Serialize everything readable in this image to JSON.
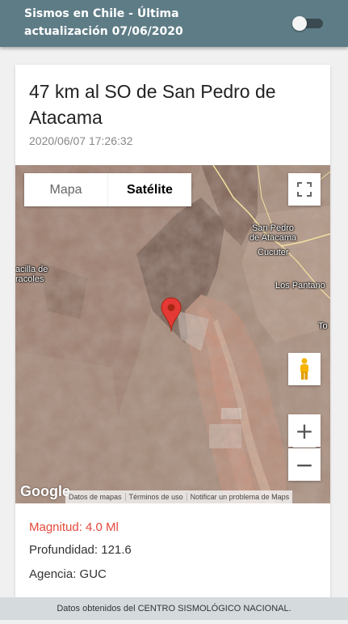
{
  "header": {
    "title": "Sismos en Chile - Última actualización 07/06/2020",
    "dark_mode_toggle": "off"
  },
  "event": {
    "title": "47 km al SO de San Pedro de Atacama",
    "datetime": "2020/06/07 17:26:32",
    "magnitude": "Magnitud: 4.0 Ml",
    "depth": "Profundidad: 121.6",
    "agency": "Agencia: GUC"
  },
  "map": {
    "type_options": [
      "Mapa",
      "Satélite"
    ],
    "selected_type": "Satélite",
    "zoom_in": "+",
    "zoom_out": "−",
    "labels": {
      "san_pedro": "San Pedro\nde Atacama",
      "cucuter": "Cucuter",
      "los_pantanos": "Los Pantano",
      "toconao": "To",
      "cacilla": "acilla de\nracoles"
    },
    "logo": "Google",
    "attribution": [
      "Datos de mapas",
      "Términos de uso",
      "Notificar un problema de Maps"
    ],
    "colors": {
      "marker": "#e53935",
      "magnitude_text": "#e5483b"
    }
  },
  "footer": {
    "text": "Datos obtenidos del CENTRO SISMOLÓGICO NACIONAL."
  }
}
